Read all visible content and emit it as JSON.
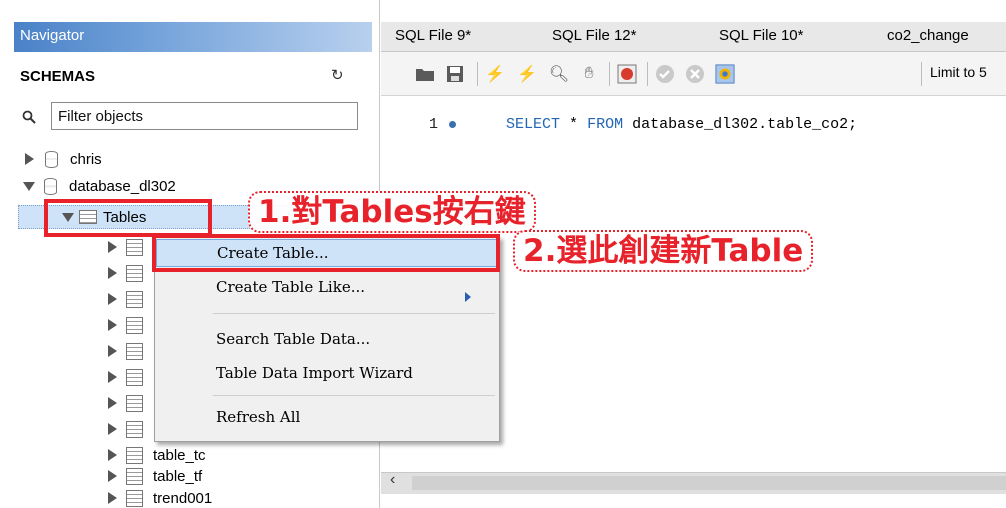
{
  "navigator": {
    "title": "Navigator",
    "schemas_title": "SCHEMAS",
    "filter_placeholder": "Filter objects",
    "schemas": [
      {
        "name": "chris"
      },
      {
        "name": "database_dl302"
      }
    ],
    "tables_node": "Tables",
    "tables_visible": [
      "table_tc",
      "table_tf",
      "trend001"
    ]
  },
  "editor": {
    "tabs": [
      "SQL File 9*",
      "SQL File 12*",
      "SQL File 10*",
      "co2_change"
    ],
    "limit_label": "Limit to 5",
    "line_number": "1",
    "sql_keyword_select": "SELECT",
    "sql_star": "*",
    "sql_keyword_from": "FROM",
    "sql_target": "database_dl302.table_co2;"
  },
  "context_menu": {
    "items": [
      "Create Table...",
      "Create Table Like...",
      "Search Table Data...",
      "Table Data Import Wizard",
      "Refresh All"
    ]
  },
  "annotations": {
    "step1": "1.對Tables按右鍵",
    "step2": "2.選此創建新Table"
  },
  "colors": {
    "annotation_red": "#e8222b",
    "navigator_header_blue": "#4a82c8",
    "selection_blue": "#cfe3f8",
    "sql_keyword_blue": "#2366b6"
  }
}
